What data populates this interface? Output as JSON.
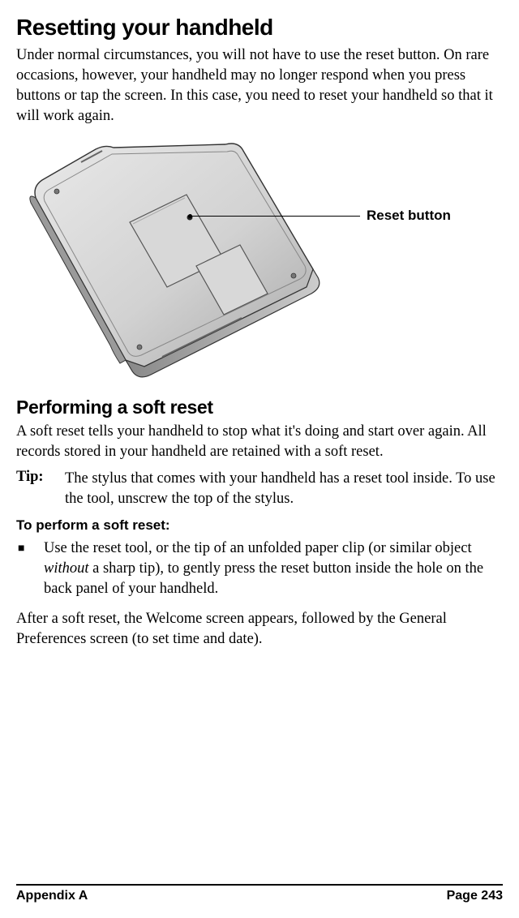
{
  "heading1": "Resetting your handheld",
  "intro_para": "Under normal circumstances, you will not have to use the reset button. On rare occasions, however, your handheld may no longer respond when you press buttons or tap the screen. In this case, you need to reset your handheld so that it will work again.",
  "figure": {
    "callout_label": "Reset button"
  },
  "heading2": "Performing a soft reset",
  "soft_reset_para": "A soft reset tells your handheld to stop what it's doing and start over again. All records stored in your handheld are retained with a soft reset.",
  "tip": {
    "label": "Tip:",
    "body": "The stylus that comes with your handheld has a reset tool inside. To use the tool, unscrew the top of the stylus."
  },
  "step_head": "To perform a soft reset:",
  "bullet": {
    "pre": "Use the reset tool, or the tip of an unfolded paper clip (or similar object ",
    "em": "without",
    "post": " a sharp tip), to gently press the reset button inside the hole on the back panel of your handheld."
  },
  "after_para": "After a soft reset, the Welcome screen appears, followed by the General Preferences screen (to set time and date).",
  "footer": {
    "left": "Appendix A",
    "right": "Page 243"
  }
}
